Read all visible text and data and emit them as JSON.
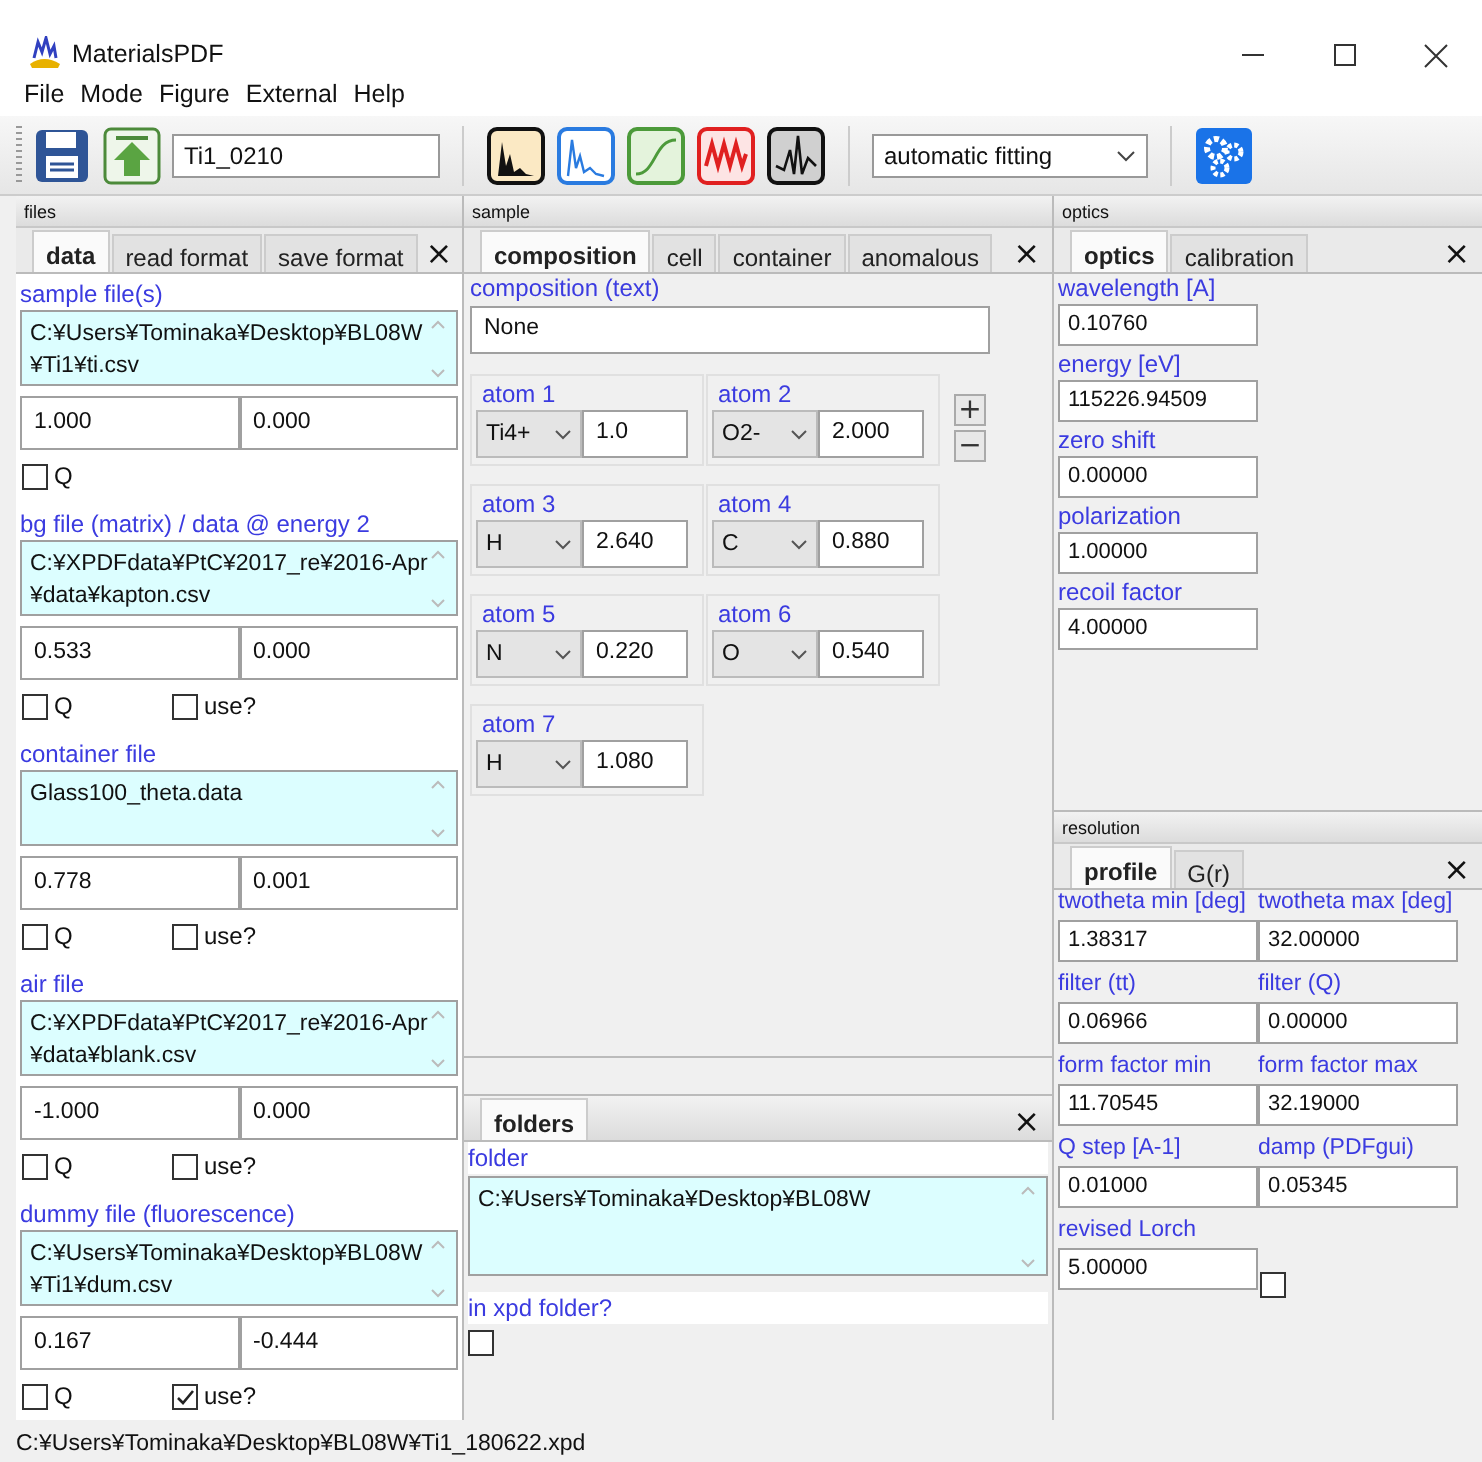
{
  "window": {
    "title": "MaterialsPDF"
  },
  "menu": [
    "File",
    "Mode",
    "Figure",
    "External",
    "Help"
  ],
  "toolbar": {
    "name_field": "Ti1_0210",
    "mode_dropdown": "automatic fitting"
  },
  "files": {
    "title": "files",
    "close": "×",
    "tabs": [
      {
        "label": "data",
        "selected": true
      },
      {
        "label": "read format",
        "selected": false
      },
      {
        "label": "save format",
        "selected": false
      }
    ],
    "sections": [
      {
        "label": "sample file(s)",
        "path": [
          "C:¥Users¥Tominaka¥Desktop¥BL08W",
          "¥Ti1¥ti.csv"
        ],
        "values": [
          "1.000",
          "0.000"
        ],
        "checks": [
          {
            "label": "Q",
            "checked": false
          }
        ]
      },
      {
        "label": "bg file (matrix) / data @ energy 2",
        "path": [
          "C:¥XPDFdata¥PtC¥2017_re¥2016-Apr",
          "¥data¥kapton.csv"
        ],
        "values": [
          "0.533",
          "0.000"
        ],
        "checks": [
          {
            "label": "Q",
            "checked": false
          },
          {
            "label": "use?",
            "checked": false
          }
        ]
      },
      {
        "label": "container file",
        "path": [
          "Glass100_theta.data"
        ],
        "values": [
          "0.778",
          "0.001"
        ],
        "checks": [
          {
            "label": "Q",
            "checked": false
          },
          {
            "label": "use?",
            "checked": false
          }
        ]
      },
      {
        "label": "air file",
        "path": [
          "C:¥XPDFdata¥PtC¥2017_re¥2016-Apr",
          "¥data¥blank.csv"
        ],
        "values": [
          "-1.000",
          "0.000"
        ],
        "checks": [
          {
            "label": "Q",
            "checked": false
          },
          {
            "label": "use?",
            "checked": false
          }
        ]
      },
      {
        "label": "dummy file (fluorescence)",
        "path": [
          "C:¥Users¥Tominaka¥Desktop¥BL08W",
          "¥Ti1¥dum.csv"
        ],
        "values": [
          "0.167",
          "-0.444"
        ],
        "checks": [
          {
            "label": "Q",
            "checked": false
          },
          {
            "label": "use?",
            "checked": true
          }
        ]
      }
    ]
  },
  "sample": {
    "title": "sample",
    "close": "×",
    "tabs": [
      {
        "label": "composition",
        "selected": true
      },
      {
        "label": "cell",
        "selected": false
      },
      {
        "label": "container",
        "selected": false
      },
      {
        "label": "anomalous",
        "selected": false
      }
    ],
    "composition_label": "composition (text)",
    "composition_value": "None",
    "add_button": "+",
    "remove_button": "−",
    "atoms": [
      {
        "label": "atom 1",
        "element": "Ti4+",
        "amount": "1.0"
      },
      {
        "label": "atom 2",
        "element": "O2-",
        "amount": "2.000"
      },
      {
        "label": "atom 3",
        "element": "H",
        "amount": "2.640"
      },
      {
        "label": "atom 4",
        "element": "C",
        "amount": "0.880"
      },
      {
        "label": "atom 5",
        "element": "N",
        "amount": "0.220"
      },
      {
        "label": "atom 6",
        "element": "O",
        "amount": "0.540"
      },
      {
        "label": "atom 7",
        "element": "H",
        "amount": "1.080"
      }
    ]
  },
  "folders": {
    "close": "×",
    "tabs": [
      {
        "label": "folders",
        "selected": true
      }
    ],
    "folder_label": "folder",
    "path": [
      "C:¥Users¥Tominaka¥Desktop¥BL08W"
    ],
    "check": {
      "label": "in xpd folder?",
      "checked": false
    }
  },
  "optics": {
    "title": "optics",
    "close": "×",
    "tabs": [
      {
        "label": "optics",
        "selected": true
      },
      {
        "label": "calibration",
        "selected": false
      }
    ],
    "fields": [
      {
        "label": "wavelength [A]",
        "value": "0.10760"
      },
      {
        "label": "energy [eV]",
        "value": "115226.94509"
      },
      {
        "label": "zero shift",
        "value": "0.00000"
      },
      {
        "label": "polarization",
        "value": "1.00000"
      },
      {
        "label": "recoil factor",
        "value": "4.00000"
      }
    ]
  },
  "resolution": {
    "title": "resolution",
    "close": "×",
    "tabs": [
      {
        "label": "profile",
        "selected": true
      },
      {
        "label": "G(r)",
        "selected": false
      }
    ],
    "fields": [
      {
        "label": "twotheta min [deg]",
        "value": "1.38317"
      },
      {
        "label": "twotheta max [deg]",
        "value": "32.00000"
      },
      {
        "label": "filter (tt)",
        "value": "0.06966"
      },
      {
        "label": "filter (Q)",
        "value": "0.00000"
      },
      {
        "label": "form factor min",
        "value": "11.70545"
      },
      {
        "label": "form factor max",
        "value": "32.19000"
      },
      {
        "label": "Q step [A-1]",
        "value": "0.01000"
      },
      {
        "label": "damp (PDFgui)",
        "value": "0.05345"
      }
    ],
    "lorch": {
      "label": "revised Lorch",
      "value": "5.00000",
      "checked": false
    }
  },
  "status_bar": "C:¥Users¥Tominaka¥Desktop¥BL08W¥Ti1_180622.xpd"
}
